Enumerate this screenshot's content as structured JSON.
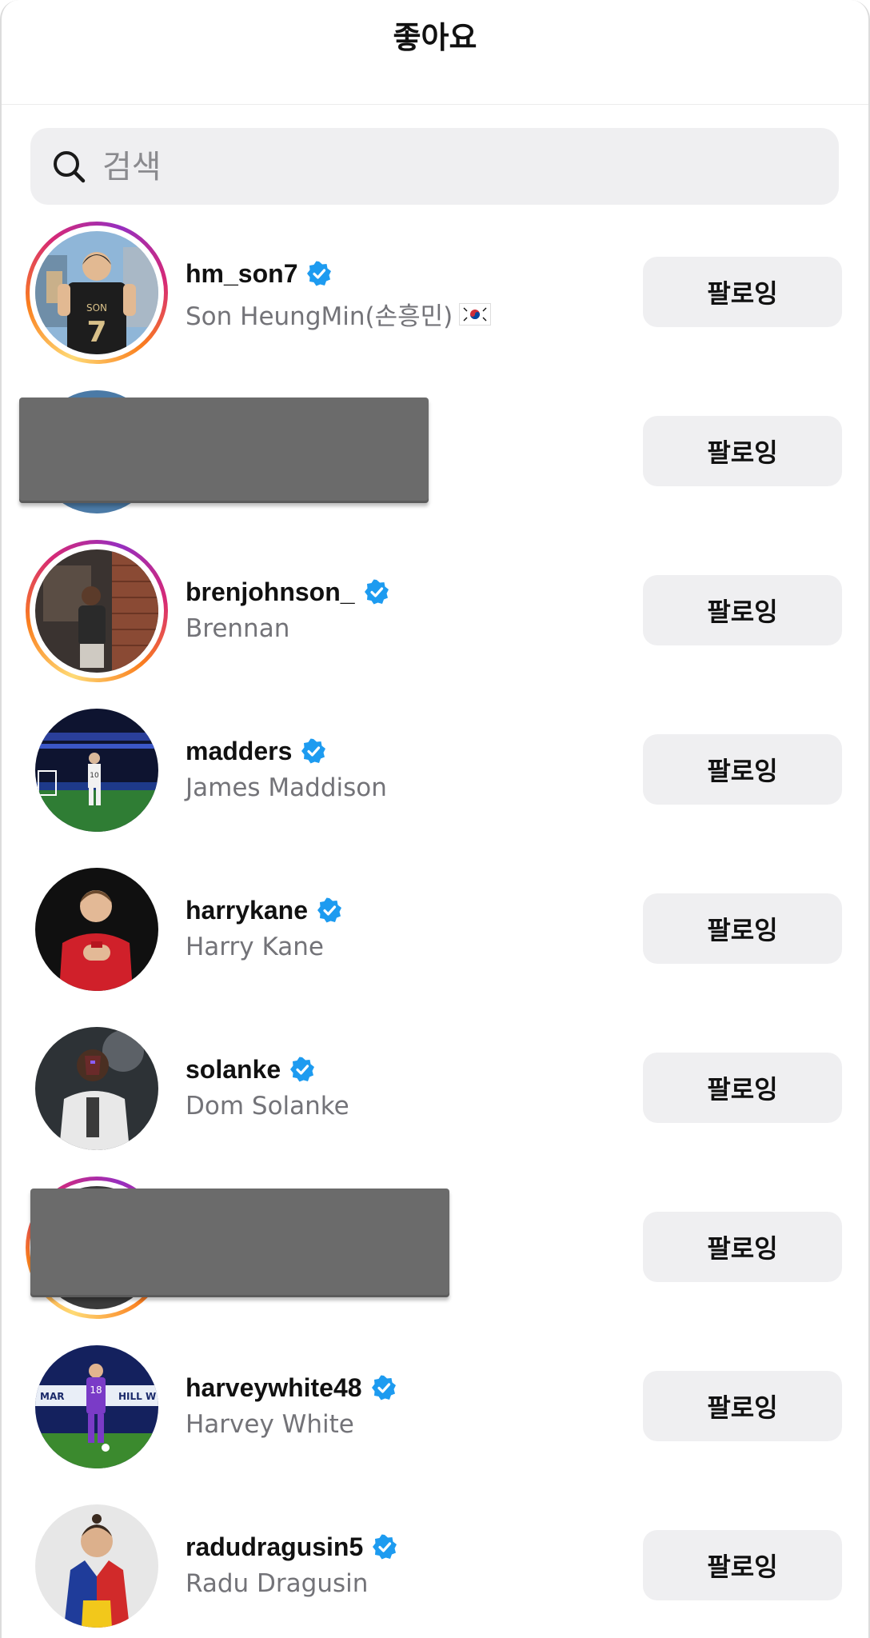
{
  "header": {
    "title": "좋아요"
  },
  "search": {
    "placeholder": "검색",
    "icon": "search-icon"
  },
  "list": [
    {
      "username": "hm_son7",
      "fullname": "Son HeungMin(손흥민)",
      "flag": "korea-flag",
      "verified": true,
      "story_ring": true,
      "button": "팔로잉"
    },
    {
      "username": "",
      "fullname": "",
      "verified": false,
      "story_ring": false,
      "redacted": true,
      "button": "팔로잉"
    },
    {
      "username": "brenjohnson_",
      "fullname": "Brennan",
      "verified": true,
      "story_ring": true,
      "button": "팔로잉"
    },
    {
      "username": "madders",
      "fullname": "James Maddison",
      "verified": true,
      "story_ring": false,
      "button": "팔로잉"
    },
    {
      "username": "harrykane",
      "fullname": "Harry Kane",
      "verified": true,
      "story_ring": false,
      "button": "팔로잉"
    },
    {
      "username": "solanke",
      "fullname": "Dom Solanke",
      "verified": true,
      "story_ring": false,
      "button": "팔로잉"
    },
    {
      "username": "",
      "fullname": "",
      "verified": false,
      "story_ring": true,
      "redacted": true,
      "button": "팔로잉"
    },
    {
      "username": "harveywhite48",
      "fullname": "Harvey White",
      "verified": true,
      "story_ring": false,
      "button": "팔로잉"
    },
    {
      "username": "radudragusin5",
      "fullname": "Radu Dragusin",
      "verified": true,
      "story_ring": false,
      "button": "팔로잉"
    }
  ],
  "colors": {
    "verified_blue": "#1d9bf0",
    "button_bg": "#efeff1",
    "secondary_text": "#737378"
  }
}
